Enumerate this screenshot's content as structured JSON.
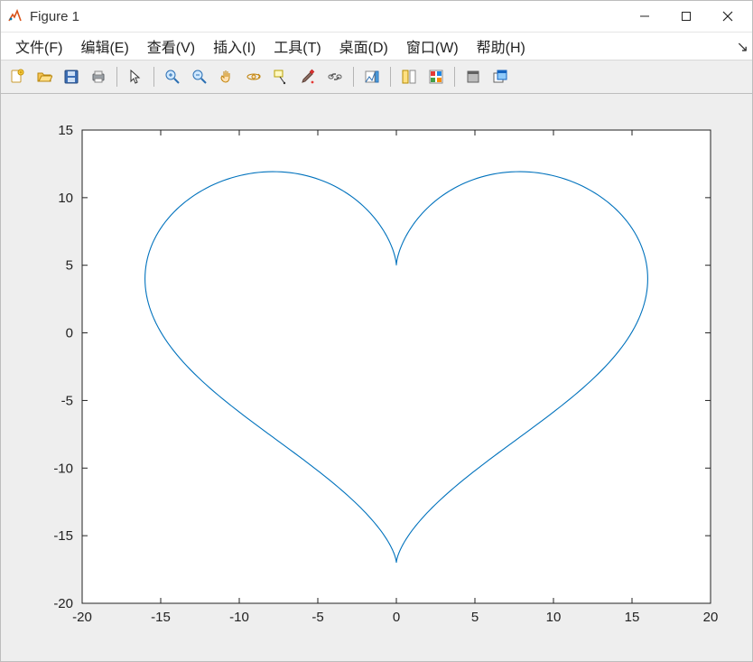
{
  "window": {
    "title": "Figure 1"
  },
  "menubar": {
    "items": [
      {
        "label": "文件(F)"
      },
      {
        "label": "编辑(E)"
      },
      {
        "label": "查看(V)"
      },
      {
        "label": "插入(I)"
      },
      {
        "label": "工具(T)"
      },
      {
        "label": "桌面(D)"
      },
      {
        "label": "窗口(W)"
      },
      {
        "label": "帮助(H)"
      }
    ],
    "more_arrow": "↘"
  },
  "toolbar": {
    "groups": [
      [
        "new-figure-icon",
        "open-file-icon",
        "save-icon",
        "print-icon"
      ],
      [
        "pointer-icon"
      ],
      [
        "zoom-in-icon",
        "zoom-out-icon",
        "pan-icon",
        "rotate3d-icon",
        "data-cursor-icon",
        "brush-icon",
        "link-icon"
      ],
      [
        "colorbar-icon"
      ],
      [
        "legend-icon",
        "plot-browser-icon"
      ],
      [
        "dock-icon",
        "undock-icon"
      ]
    ]
  },
  "chart_data": {
    "type": "line",
    "description": "Heart-shaped parametric curve: x = 16·sin³(t), y = 13·cos(t) − 5·cos(2t) − 2·cos(3t) − cos(4t), t ∈ [0, 2π]",
    "series": [
      {
        "name": "heart",
        "color": "#0072BD",
        "param": "t ∈ [0, 2π]",
        "x_formula": "16*sin(t)^3",
        "y_formula": "13*cos(t) - 5*cos(2t) - 2*cos(3t) - cos(4t)",
        "sample_points_t": [
          0,
          0.3927,
          0.7854,
          1.1781,
          1.5708,
          1.9635,
          2.3562,
          2.7489,
          3.1416,
          3.5343,
          3.927,
          4.3197,
          4.7124,
          5.1051,
          5.4978,
          5.8905
        ],
        "sample_x": [
          0.0,
          0.9,
          5.66,
          12.6,
          16.0,
          12.6,
          5.66,
          0.9,
          0.0,
          -0.9,
          -5.66,
          -12.6,
          -16.0,
          -12.6,
          -5.66,
          -0.9
        ],
        "sample_y": [
          5.0,
          10.64,
          11.9,
          8.48,
          2.0,
          -5.17,
          -10.49,
          -14.39,
          -17.0,
          -14.39,
          -10.49,
          -5.17,
          2.0,
          8.48,
          11.9,
          10.64
        ]
      }
    ],
    "xlim": [
      -20,
      20
    ],
    "ylim": [
      -20,
      15
    ],
    "xticks": [
      -20,
      -15,
      -10,
      -5,
      0,
      5,
      10,
      15,
      20
    ],
    "yticks": [
      -20,
      -15,
      -10,
      -5,
      0,
      5,
      10,
      15
    ],
    "xlabel": "",
    "ylabel": "",
    "title": "",
    "grid": false,
    "box": true,
    "background": "#ffffff"
  }
}
